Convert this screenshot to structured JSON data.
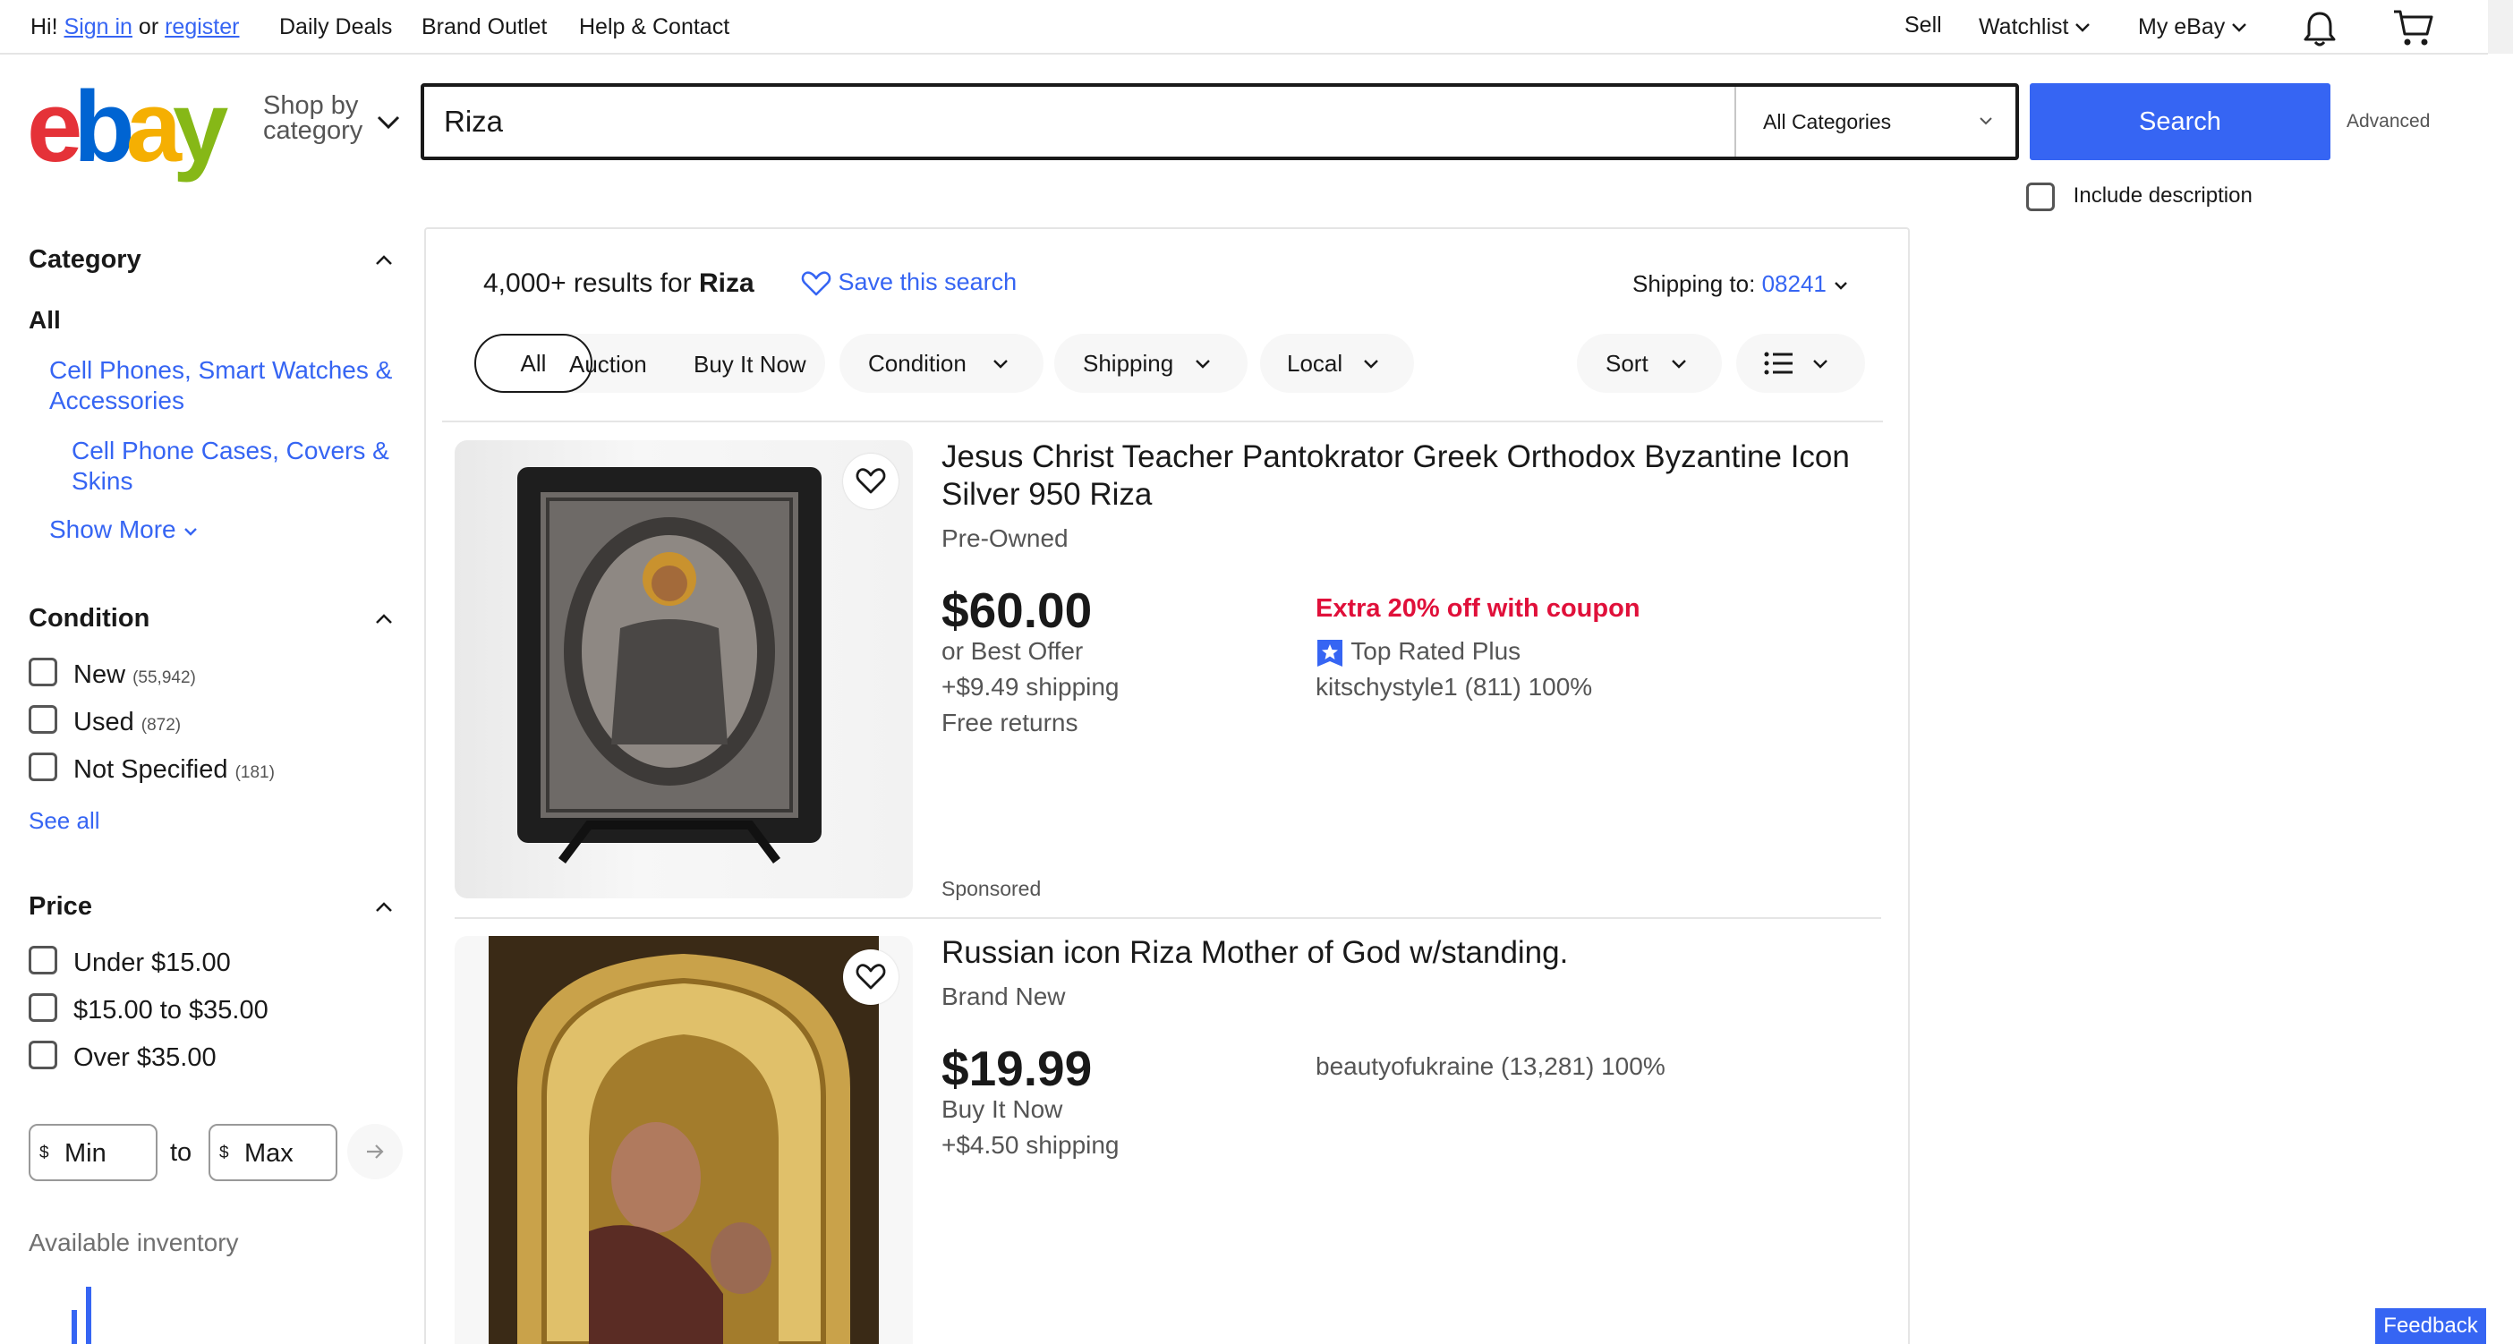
{
  "topbar": {
    "greeting": "Hi!",
    "sign_in": "Sign in",
    "or": "or",
    "register": "register",
    "daily_deals": "Daily Deals",
    "brand_outlet": "Brand Outlet",
    "help": "Help & Contact",
    "sell": "Sell",
    "watchlist": "Watchlist",
    "my_ebay": "My eBay",
    "icons": [
      "bell-icon",
      "cart-icon"
    ]
  },
  "header": {
    "logo_letters": [
      "e",
      "b",
      "a",
      "y"
    ],
    "logo_colors": [
      "#e53238",
      "#0064d2",
      "#f5af02",
      "#86b817"
    ],
    "shop_by_line1": "Shop by",
    "shop_by_line2": "category",
    "search_value": "Riza",
    "category_select": "All Categories",
    "search_button": "Search",
    "advanced": "Advanced",
    "include_description": "Include description"
  },
  "sidebar": {
    "category_heading": "Category",
    "all": "All",
    "cat_link_1": "Cell Phones, Smart Watches & Accessories",
    "cat_link_2": "Cell Phone Cases, Covers & Skins",
    "show_more": "Show More",
    "condition_heading": "Condition",
    "conditions": [
      {
        "label": "New",
        "count": "(55,942)"
      },
      {
        "label": "Used",
        "count": "(872)"
      },
      {
        "label": "Not Specified",
        "count": "(181)"
      }
    ],
    "see_all": "See all",
    "price_heading": "Price",
    "prices": [
      "Under $15.00",
      "$15.00 to $35.00",
      "Over $35.00"
    ],
    "min_placeholder": "Min",
    "max_placeholder": "Max",
    "currency": "$",
    "to": "to",
    "available_inventory": "Available inventory"
  },
  "results": {
    "count_prefix": "4,000+ results for",
    "query": "Riza",
    "save_search": "Save this search",
    "shipping_to_label": "Shipping to:",
    "zip": "08241",
    "filters": {
      "all": "All",
      "auction": "Auction",
      "buy_it_now": "Buy It Now",
      "condition": "Condition",
      "shipping": "Shipping",
      "local": "Local",
      "sort": "Sort"
    }
  },
  "items": [
    {
      "title": "Jesus Christ Teacher Pantokrator Greek Orthodox Byzantine Icon Silver 950 Riza",
      "condition": "Pre-Owned",
      "price": "$60.00",
      "format": "or Best Offer",
      "shipping": "+$9.49 shipping",
      "returns": "Free returns",
      "promo": "Extra 20% off with coupon",
      "badge": "Top Rated Plus",
      "seller": "kitschystyle1 (811) 100%",
      "sponsored": "Sponsored"
    },
    {
      "title": "Russian icon Riza Mother of God w/standing.",
      "condition": "Brand New",
      "price": "$19.99",
      "format": "Buy It Now",
      "shipping": "+$4.50 shipping",
      "seller": "beautyofukraine (13,281) 100%"
    }
  ],
  "feedback": "Feedback",
  "colors": {
    "accent": "#3665f3",
    "promo": "#e0103a"
  }
}
